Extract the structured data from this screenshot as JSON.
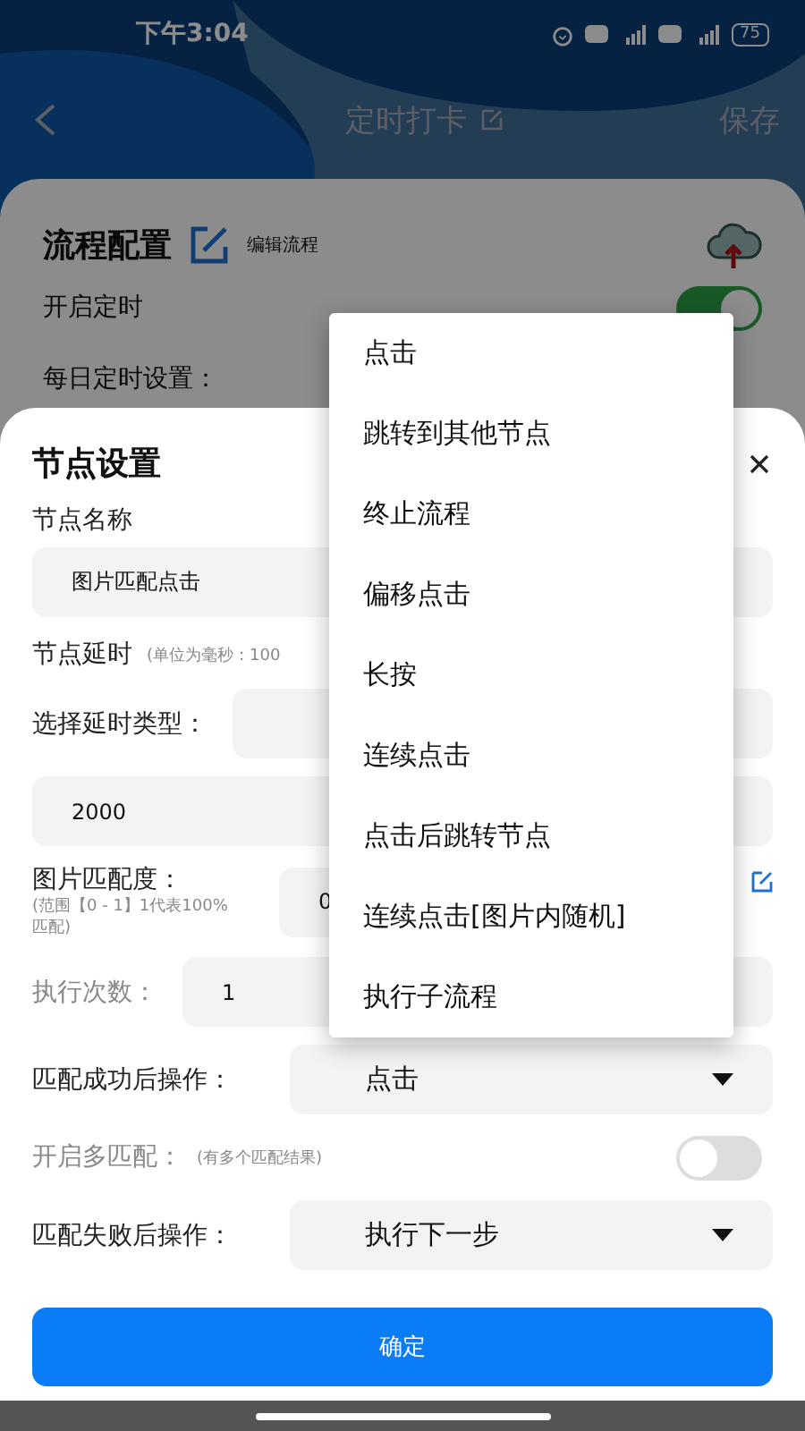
{
  "status_bar": {
    "time": "下午3:04",
    "battery": "75"
  },
  "header": {
    "title": "定时打卡",
    "action": "保存"
  },
  "flow_card": {
    "title": "流程配置",
    "edit_label": "编辑流程",
    "rows": [
      {
        "kind": "toggle",
        "label": "开启定时",
        "on": true
      },
      {
        "kind": "text",
        "label": "每日定时设置："
      }
    ]
  },
  "node_sheet": {
    "title": "节点设置",
    "fields": [
      {
        "kind": "stacked",
        "label": "节点名称",
        "value": "图片匹配点击",
        "disabled": false
      },
      {
        "kind": "heading",
        "label": "节点延时",
        "note": "(单位为毫秒：100",
        "disabled": false
      },
      {
        "kind": "inline",
        "label": "选择延时类型：",
        "disabled": false
      },
      {
        "kind": "full",
        "value": "2000"
      },
      {
        "kind": "ratio",
        "label": "图片匹配度：",
        "note": "(范围【0 - 1】1代表100%匹配)",
        "value": "0",
        "disabled": false
      },
      {
        "kind": "inline",
        "label": "执行次数：",
        "value": "1",
        "disabled": true
      },
      {
        "kind": "select",
        "label": "匹配成功后操作：",
        "value": "点击",
        "disabled": false
      },
      {
        "kind": "toggle",
        "label": "开启多匹配：",
        "note": "(有多个匹配结果)",
        "on": false,
        "disabled": true
      },
      {
        "kind": "select",
        "label": "匹配失败后操作：",
        "value": "执行下一步",
        "disabled": false
      }
    ],
    "confirm": "确定"
  },
  "menu": {
    "items": [
      "点击",
      "跳转到其他节点",
      "终止流程",
      "偏移点击",
      "长按",
      "连续点击",
      "点击后跳转节点",
      "连续点击[图片内随机]",
      "执行子流程"
    ]
  }
}
